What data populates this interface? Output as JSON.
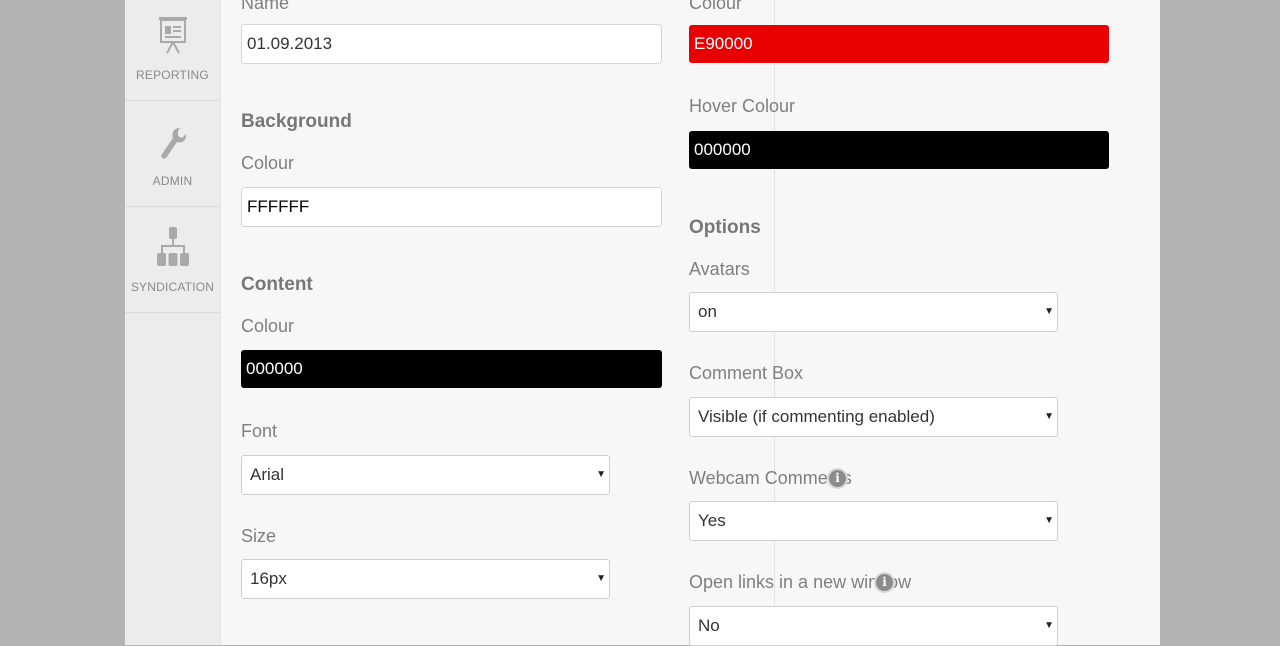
{
  "sidebar": {
    "items": [
      {
        "label": "REPORTING",
        "icon": "presentation-board-icon"
      },
      {
        "label": "ADMIN",
        "icon": "wrench-icon"
      },
      {
        "label": "SYNDICATION",
        "icon": "org-chart-icon"
      }
    ]
  },
  "left": {
    "name_label": "Name",
    "name_value": "01.09.2013",
    "background_heading": "Background",
    "background_colour_label": "Colour",
    "background_colour_value": "FFFFFF",
    "content_heading": "Content",
    "content_colour_label": "Colour",
    "content_colour_value": "000000",
    "font_label": "Font",
    "font_value": "Arial",
    "size_label": "Size",
    "size_value": "16px"
  },
  "right": {
    "colour_label": "Colour",
    "colour_value": "E90000",
    "hover_colour_label": "Hover Colour",
    "hover_colour_value": "000000",
    "options_heading": "Options",
    "avatars_label": "Avatars",
    "avatars_value": "on",
    "comment_box_label": "Comment Box",
    "comment_box_value": "Visible (if commenting enabled)",
    "webcam_label": "Webcam Comments",
    "webcam_value": "Yes",
    "new_window_label": "Open links in a new window",
    "new_window_value": "No"
  },
  "colors": {
    "accent_red": "#e90000",
    "black": "#000000",
    "white": "#ffffff"
  }
}
